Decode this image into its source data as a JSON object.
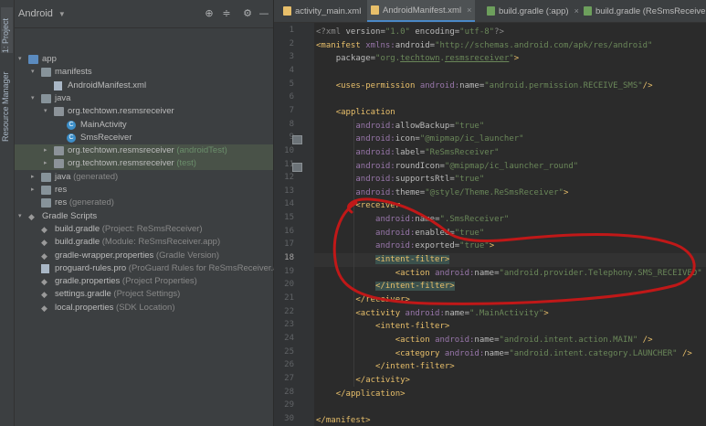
{
  "side_tabs": [
    "1: Project",
    "Resource Manager"
  ],
  "project": {
    "view": "Android",
    "tree": [
      {
        "label": "app",
        "sub": "",
        "depth": 0,
        "arrow": "▾",
        "icon": "folder-blue",
        "hl": false
      },
      {
        "label": "manifests",
        "sub": "",
        "depth": 1,
        "arrow": "▾",
        "icon": "folder",
        "hl": false
      },
      {
        "label": "AndroidManifest.xml",
        "sub": "",
        "depth": 2,
        "arrow": "",
        "icon": "file",
        "hl": false
      },
      {
        "label": "java",
        "sub": "",
        "depth": 1,
        "arrow": "▾",
        "icon": "folder",
        "hl": false
      },
      {
        "label": "org.techtown.resmsreceiver",
        "sub": "",
        "depth": 2,
        "arrow": "▾",
        "icon": "pkg",
        "hl": false
      },
      {
        "label": "MainActivity",
        "sub": "",
        "depth": 3,
        "arrow": "",
        "icon": "class",
        "hl": false
      },
      {
        "label": "SmsReceiver",
        "sub": "",
        "depth": 3,
        "arrow": "",
        "icon": "class",
        "hl": false
      },
      {
        "label": "org.techtown.resmsreceiver",
        "sub": "(androidTest)",
        "depth": 2,
        "arrow": "▸",
        "icon": "pkg",
        "hl": true
      },
      {
        "label": "org.techtown.resmsreceiver",
        "sub": "(test)",
        "depth": 2,
        "arrow": "▸",
        "icon": "pkg",
        "hl": true
      },
      {
        "label": "java",
        "sub": "(generated)",
        "depth": 1,
        "arrow": "▸",
        "icon": "folder",
        "hl": false
      },
      {
        "label": "res",
        "sub": "",
        "depth": 1,
        "arrow": "▸",
        "icon": "folder",
        "hl": false
      },
      {
        "label": "res",
        "sub": "(generated)",
        "depth": 1,
        "arrow": "",
        "icon": "folder",
        "hl": false
      },
      {
        "label": "Gradle Scripts",
        "sub": "",
        "depth": 0,
        "arrow": "▾",
        "icon": "gradle",
        "hl": false
      },
      {
        "label": "build.gradle",
        "sub": "(Project: ReSmsReceiver)",
        "depth": 1,
        "arrow": "",
        "icon": "gradle",
        "hl": false
      },
      {
        "label": "build.gradle",
        "sub": "(Module: ReSmsReceiver.app)",
        "depth": 1,
        "arrow": "",
        "icon": "gradle",
        "hl": false
      },
      {
        "label": "gradle-wrapper.properties",
        "sub": "(Gradle Version)",
        "depth": 1,
        "arrow": "",
        "icon": "gradle",
        "hl": false
      },
      {
        "label": "proguard-rules.pro",
        "sub": "(ProGuard Rules for ReSmsReceiver.app)",
        "depth": 1,
        "arrow": "",
        "icon": "file",
        "hl": false
      },
      {
        "label": "gradle.properties",
        "sub": "(Project Properties)",
        "depth": 1,
        "arrow": "",
        "icon": "gradle",
        "hl": false
      },
      {
        "label": "settings.gradle",
        "sub": "(Project Settings)",
        "depth": 1,
        "arrow": "",
        "icon": "gradle",
        "hl": false
      },
      {
        "label": "local.properties",
        "sub": "(SDK Location)",
        "depth": 1,
        "arrow": "",
        "icon": "gradle",
        "hl": false
      }
    ]
  },
  "tabs": [
    {
      "label": "activity_main.xml",
      "active": false
    },
    {
      "label": "AndroidManifest.xml",
      "active": true
    },
    {
      "label": "build.gradle (:app)",
      "active": false
    },
    {
      "label": "build.gradle (ReSmsReceiver)",
      "active": false
    }
  ],
  "editor": {
    "current_line": 18,
    "lines": [
      [
        [
          "?",
          "<?xml "
        ],
        [
          "a",
          "version="
        ],
        [
          "v",
          "\"1.0\" "
        ],
        [
          "a",
          "encoding="
        ],
        [
          "v",
          "\"utf-8\""
        ],
        [
          "?",
          "?>"
        ]
      ],
      [
        [
          "t",
          "<manifest "
        ],
        [
          "ns",
          "xmlns:"
        ],
        [
          "a",
          "android="
        ],
        [
          "v",
          "\"http://schemas.android.com/apk/res/android\""
        ]
      ],
      [
        [
          "s",
          "    "
        ],
        [
          "a",
          "package="
        ],
        [
          "v",
          "\"org.techtown.resmsreceiver\""
        ],
        [
          "t",
          ">"
        ]
      ],
      [],
      [
        [
          "s",
          "    "
        ],
        [
          "t",
          "<uses-permission "
        ],
        [
          "ns",
          "android:"
        ],
        [
          "a",
          "name="
        ],
        [
          "v",
          "\"android.permission.RECEIVE_SMS\""
        ],
        [
          "t",
          "/>"
        ]
      ],
      [],
      [
        [
          "s",
          "    "
        ],
        [
          "t",
          "<application"
        ]
      ],
      [
        [
          "s",
          "        "
        ],
        [
          "ns",
          "android:"
        ],
        [
          "a",
          "allowBackup="
        ],
        [
          "v",
          "\"true\""
        ]
      ],
      [
        [
          "s",
          "        "
        ],
        [
          "ns",
          "android:"
        ],
        [
          "a",
          "icon="
        ],
        [
          "v",
          "\"@mipmap/ic_launcher\""
        ]
      ],
      [
        [
          "s",
          "        "
        ],
        [
          "ns",
          "android:"
        ],
        [
          "a",
          "label="
        ],
        [
          "v",
          "\"ReSmsReceiver\""
        ]
      ],
      [
        [
          "s",
          "        "
        ],
        [
          "ns",
          "android:"
        ],
        [
          "a",
          "roundIcon="
        ],
        [
          "v",
          "\"@mipmap/ic_launcher_round\""
        ]
      ],
      [
        [
          "s",
          "        "
        ],
        [
          "ns",
          "android:"
        ],
        [
          "a",
          "supportsRtl="
        ],
        [
          "v",
          "\"true\""
        ]
      ],
      [
        [
          "s",
          "        "
        ],
        [
          "ns",
          "android:"
        ],
        [
          "a",
          "theme="
        ],
        [
          "v",
          "\"@style/Theme.ReSmsReceiver\""
        ],
        [
          "t",
          ">"
        ]
      ],
      [
        [
          "s",
          "        "
        ],
        [
          "t",
          "<receiver"
        ]
      ],
      [
        [
          "s",
          "            "
        ],
        [
          "ns",
          "android:"
        ],
        [
          "a",
          "name="
        ],
        [
          "v",
          "\".SmsReceiver\""
        ]
      ],
      [
        [
          "s",
          "            "
        ],
        [
          "ns",
          "android:"
        ],
        [
          "a",
          "enabled="
        ],
        [
          "v",
          "\"true\""
        ]
      ],
      [
        [
          "s",
          "            "
        ],
        [
          "ns",
          "android:"
        ],
        [
          "a",
          "exported="
        ],
        [
          "v",
          "\"true\""
        ],
        [
          "t",
          ">"
        ]
      ],
      [
        [
          "s",
          "            "
        ],
        [
          "th",
          "<intent-filter>"
        ]
      ],
      [
        [
          "s",
          "                "
        ],
        [
          "t",
          "<action "
        ],
        [
          "ns",
          "android:"
        ],
        [
          "a",
          "name="
        ],
        [
          "v",
          "\"android.provider.Telephony.SMS_RECEIVED\" "
        ],
        [
          "t",
          "/>"
        ]
      ],
      [
        [
          "s",
          "            "
        ],
        [
          "th",
          "</intent-filter>"
        ]
      ],
      [
        [
          "s",
          "        "
        ],
        [
          "t",
          "</receiver>"
        ]
      ],
      [
        [
          "s",
          "        "
        ],
        [
          "t",
          "<activity "
        ],
        [
          "ns",
          "android:"
        ],
        [
          "a",
          "name="
        ],
        [
          "v",
          "\".MainActivity\""
        ],
        [
          "t",
          ">"
        ]
      ],
      [
        [
          "s",
          "            "
        ],
        [
          "t",
          "<intent-filter>"
        ]
      ],
      [
        [
          "s",
          "                "
        ],
        [
          "t",
          "<action "
        ],
        [
          "ns",
          "android:"
        ],
        [
          "a",
          "name="
        ],
        [
          "v",
          "\"android.intent.action.MAIN\" "
        ],
        [
          "t",
          "/>"
        ]
      ],
      [
        [
          "s",
          "                "
        ],
        [
          "t",
          "<category "
        ],
        [
          "ns",
          "android:"
        ],
        [
          "a",
          "name="
        ],
        [
          "v",
          "\"android.intent.category.LAUNCHER\" "
        ],
        [
          "t",
          "/>"
        ]
      ],
      [
        [
          "s",
          "            "
        ],
        [
          "t",
          "</intent-filter>"
        ]
      ],
      [
        [
          "s",
          "        "
        ],
        [
          "t",
          "</activity>"
        ]
      ],
      [
        [
          "s",
          "    "
        ],
        [
          "t",
          "</application>"
        ]
      ],
      [],
      [
        [
          "t",
          "</manifest>"
        ]
      ]
    ]
  },
  "colors": {
    "annotation_circle": "#c01818"
  }
}
